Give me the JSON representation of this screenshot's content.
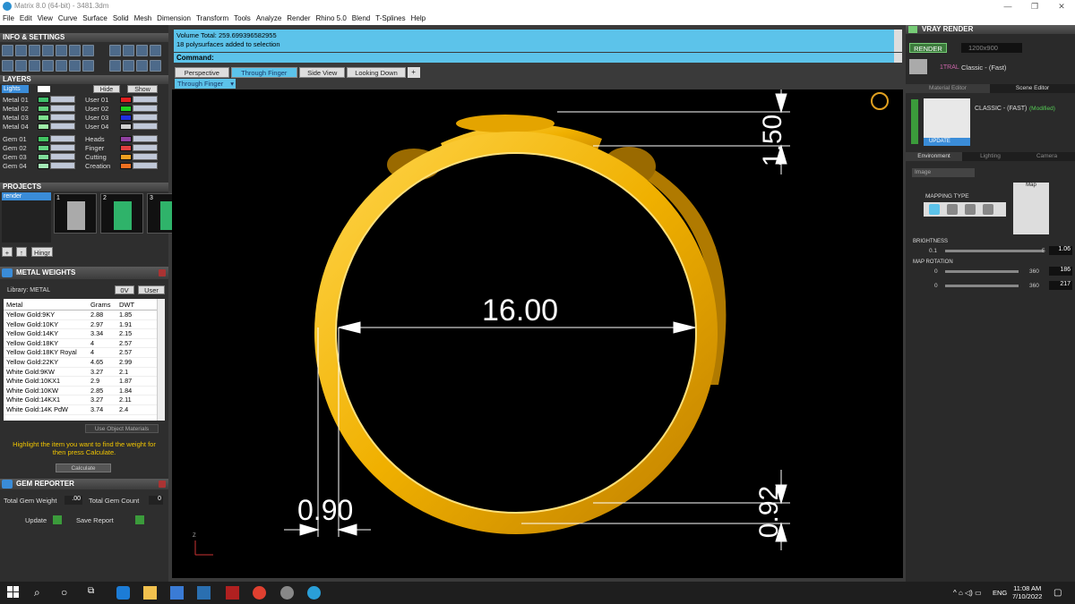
{
  "window": {
    "title": "Matrix 8.0 (64-bit) - 3481.3dm"
  },
  "menu": [
    "File",
    "Edit",
    "View",
    "Curve",
    "Surface",
    "Solid",
    "Mesh",
    "Dimension",
    "Transform",
    "Tools",
    "Analyze",
    "Render",
    "Rhino 5.0",
    "Blend",
    "T-Splines",
    "Help"
  ],
  "left": {
    "info_title": "INFO & SETTINGS",
    "layers_title": "LAYERS",
    "lights_label": "Lights",
    "hide_label": "Hide",
    "show_label": "Show",
    "layers_left": [
      {
        "name": "Metal 01",
        "color": "#3fbf6a"
      },
      {
        "name": "Metal 02",
        "color": "#5fd07a"
      },
      {
        "name": "Metal 03",
        "color": "#7ee08f"
      },
      {
        "name": "Metal 04",
        "color": "#9eeaa8"
      },
      {
        "name": "Gem 01",
        "color": "#41c462"
      },
      {
        "name": "Gem 02",
        "color": "#63d483"
      },
      {
        "name": "Gem 03",
        "color": "#7fdc9a"
      },
      {
        "name": "Gem 04",
        "color": "#a3e8b6"
      }
    ],
    "layers_right": [
      {
        "name": "User 01",
        "color": "#e02020"
      },
      {
        "name": "User 02",
        "color": "#20d020"
      },
      {
        "name": "User 03",
        "color": "#2030e0"
      },
      {
        "name": "User 04",
        "color": "#cfcfcf"
      },
      {
        "name": "Heads",
        "color": "#9040a0"
      },
      {
        "name": "Finger",
        "color": "#e04040"
      },
      {
        "name": "Cutting",
        "color": "#f0a020"
      },
      {
        "name": "Creation",
        "color": "#f07020"
      }
    ],
    "projects_title": "PROJECTS",
    "project_item": "render",
    "project_thumbs": [
      "1",
      "2",
      "3"
    ],
    "hinge_label": "Hingr",
    "metal_title": "METAL WEIGHTS",
    "library_label": "Library: METAL",
    "library_user": "User",
    "table_headers": [
      "Metal",
      "Grams",
      "DWT"
    ],
    "metal_rows": [
      [
        "Yellow Gold:9KY",
        "2.88",
        "1.85"
      ],
      [
        "Yellow Gold:10KY",
        "2.97",
        "1.91"
      ],
      [
        "Yellow Gold:14KY",
        "3.34",
        "2.15"
      ],
      [
        "Yellow Gold:18KY",
        "4",
        "2.57"
      ],
      [
        "Yellow Gold:18KY Royal",
        "4",
        "2.57"
      ],
      [
        "Yellow Gold:22KY",
        "4.65",
        "2.99"
      ],
      [
        "White Gold:9KW",
        "3.27",
        "2.1"
      ],
      [
        "White Gold:10KX1",
        "2.9",
        "1.87"
      ],
      [
        "White Gold:10KW",
        "2.85",
        "1.84"
      ],
      [
        "White Gold:14KX1",
        "3.27",
        "2.11"
      ],
      [
        "White Gold:14K PdW",
        "3.74",
        "2.4"
      ]
    ],
    "use_object_materials": "Use Object Materials",
    "hint": "Highlight the item you want to find the weight for then press Calculate.",
    "calculate": "Calculate",
    "gem_title": "GEM REPORTER",
    "total_gem_weight_label": "Total Gem Weight",
    "total_gem_weight": ".00",
    "total_gem_count_label": "Total Gem Count",
    "total_gem_count": "0",
    "update": "Update",
    "save_report": "Save Report"
  },
  "command": {
    "line1": "Volume Total: 259.699396582955",
    "line2": "18 polysurfaces added to selection",
    "label": "Command:"
  },
  "view_tabs": [
    "Perspective",
    "Through Finger",
    "Side View",
    "Looking Down"
  ],
  "active_view": "Through Finger",
  "dims": {
    "diameter": "16.00",
    "top": "1.50",
    "left": "0.90",
    "bottom": "0.92"
  },
  "axis_label": "Z",
  "right": {
    "title": "VRAY RENDER",
    "render_btn": "RENDER",
    "resolution": "1200x900",
    "preset_prefix": "1TRAL",
    "preset": "Classic - (Fast)",
    "tabs": [
      "Material Editor",
      "Scene Editor"
    ],
    "scene_name": "CLASSIC - (FAST)",
    "modified": "(Modified)",
    "update": "UPDATE",
    "env_tabs": [
      "Environment",
      "Lighting",
      "Camera"
    ],
    "env_select": "Image",
    "mapping_type": "MAPPING TYPE",
    "map_label": "Map",
    "brightness_label": "BRIGHTNESS",
    "brightness_min": "0.1",
    "brightness_max": "5",
    "brightness": "1.06",
    "map_rotation_label": "MAP ROTATION",
    "rot1_min": "0",
    "rot1_max": "360",
    "rot1": "186",
    "rot2_min": "0",
    "rot2_max": "360",
    "rot2": "217"
  },
  "taskbar": {
    "lang": "ENG",
    "time": "11:08 AM",
    "date": "7/10/2022"
  }
}
